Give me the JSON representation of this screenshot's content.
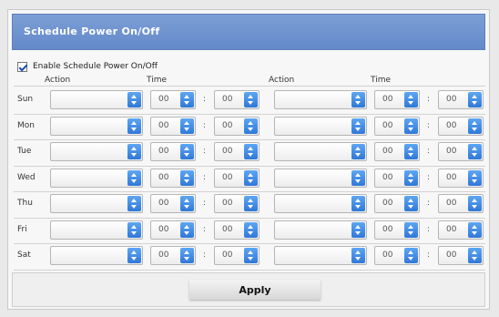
{
  "header": {
    "title": "Schedule Power On/Off"
  },
  "enable": {
    "label": "Enable Schedule Power On/Off",
    "checked": true
  },
  "columns": {
    "action1": "Action",
    "time1": "Time",
    "action2": "Action",
    "time2": "Time"
  },
  "days": [
    "Sun",
    "Mon",
    "Tue",
    "Wed",
    "Thu",
    "Fri",
    "Sat"
  ],
  "defaults": {
    "action": "",
    "hour": "00",
    "minute": "00",
    "separator": ":"
  },
  "footer": {
    "apply_label": "Apply"
  }
}
